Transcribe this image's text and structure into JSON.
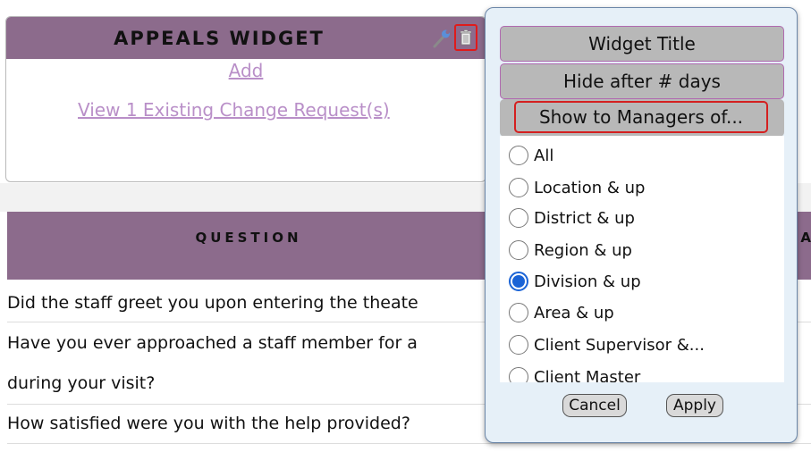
{
  "widget": {
    "title": "APPEALS WIDGET",
    "add_link": "Add",
    "view_link": "View 1 Existing Change Request(s)",
    "icons": [
      "wrench-icon",
      "trash-icon"
    ]
  },
  "table": {
    "question_header": "QUESTION",
    "partial_header": "A",
    "rows": [
      "Did the staff greet you upon entering the theate",
      "Have you ever approached a staff member for a",
      "during your visit?",
      "How satisfied were you with the help provided?"
    ]
  },
  "popup": {
    "widget_title_btn": "Widget Title",
    "hide_after_btn": "Hide after # days",
    "show_to_managers_btn": "Show to Managers of...",
    "options": [
      {
        "label": "All",
        "checked": false
      },
      {
        "label": "Location & up",
        "checked": false
      },
      {
        "label": "District & up",
        "checked": false
      },
      {
        "label": "Region & up",
        "checked": false
      },
      {
        "label": "Division & up",
        "checked": true
      },
      {
        "label": "Area & up",
        "checked": false
      },
      {
        "label": "Client Supervisor &...",
        "checked": false
      },
      {
        "label": "Client Master",
        "checked": false
      }
    ],
    "cancel_label": "Cancel",
    "apply_label": "Apply"
  },
  "colors": {
    "header_purple": "#8c6b8c",
    "link_purple": "#b98fc8",
    "popup_bg": "#e6f0f8",
    "radio_blue": "#1a63d6",
    "highlight_red": "#d42020"
  }
}
